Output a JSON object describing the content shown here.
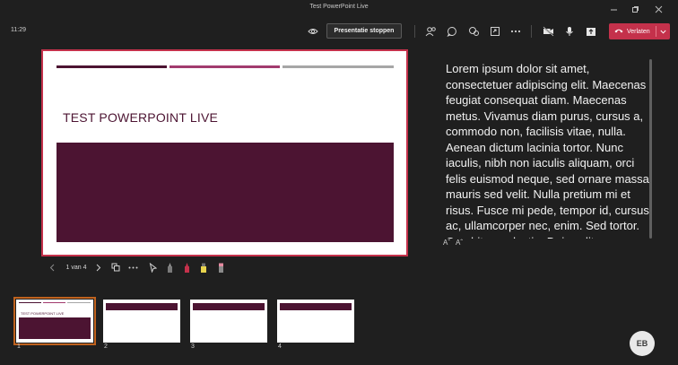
{
  "window": {
    "title": "Test PowerPoint Live",
    "controls": {
      "minimize": "minimize-icon",
      "restore": "restore-icon",
      "close": "close-icon"
    }
  },
  "meeting": {
    "time": "11:29",
    "stop_presenting_label": "Presentatie stoppen",
    "leave_label": "Verlaten",
    "accent_color": "#c4314b"
  },
  "slide": {
    "title": "TEST POWERPOINT LIVE",
    "accent_color": "#4c1432",
    "bar_colors": [
      "#4c1432",
      "#a23b6e",
      "#a6a6a6"
    ]
  },
  "notes": {
    "text": "Lorem ipsum dolor sit amet, consectetuer adipiscing elit. Maecenas feugiat consequat diam. Maecenas metus. Vivamus diam purus, cursus a, commodo non, facilisis vitae, nulla. Aenean dictum lacinia tortor. Nunc iaculis, nibh non iaculis aliquam, orci felis euismod neque, sed ornare massa mauris sed velit. Nulla pretium mi et risus. Fusce mi pede, tempor id, cursus ac, ullamcorper nec, enim. Sed tortor. Curabitur molestie. Duis velit",
    "font_decrease": "Aˇ",
    "font_increase": "Aˆ"
  },
  "controls": {
    "page_counter": "1 van 4"
  },
  "thumbnails": [
    {
      "number": "1",
      "title": "TEST POWERPOINT LIVE",
      "selected": true
    },
    {
      "number": "2",
      "title": "",
      "selected": false
    },
    {
      "number": "3",
      "title": "",
      "selected": false
    },
    {
      "number": "4",
      "title": "",
      "selected": false
    }
  ],
  "user": {
    "initials": "EB"
  }
}
